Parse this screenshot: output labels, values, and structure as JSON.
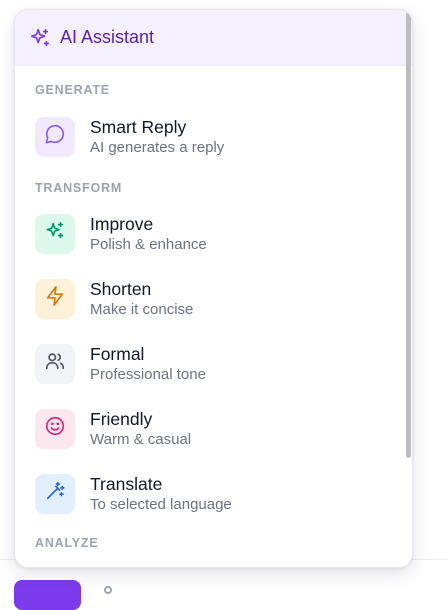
{
  "panel": {
    "title": "AI Assistant",
    "header_icon": "sparkles-icon",
    "accent": "#7c3aed"
  },
  "sections": [
    {
      "label": "GENERATE",
      "items": [
        {
          "title": "Smart Reply",
          "subtitle": "AI generates a reply",
          "icon": "message-circle-icon",
          "tile_bg": "#f1eafe",
          "icon_color": "#8b5cf6"
        }
      ]
    },
    {
      "label": "TRANSFORM",
      "items": [
        {
          "title": "Improve",
          "subtitle": "Polish & enhance",
          "icon": "sparkles-icon",
          "tile_bg": "#dcf7ec",
          "icon_color": "#059669"
        },
        {
          "title": "Shorten",
          "subtitle": "Make it concise",
          "icon": "lightning-icon",
          "tile_bg": "#fdf1d8",
          "icon_color": "#d97706"
        },
        {
          "title": "Formal",
          "subtitle": "Professional tone",
          "icon": "users-icon",
          "tile_bg": "#f1f3f6",
          "icon_color": "#4b5563"
        },
        {
          "title": "Friendly",
          "subtitle": "Warm & casual",
          "icon": "smile-icon",
          "tile_bg": "#fde7ef",
          "icon_color": "#db2777"
        },
        {
          "title": "Translate",
          "subtitle": "To selected language",
          "icon": "magic-wand-icon",
          "tile_bg": "#e1effd",
          "icon_color": "#2563eb"
        }
      ]
    },
    {
      "label": "ANALYZE",
      "items": []
    }
  ]
}
